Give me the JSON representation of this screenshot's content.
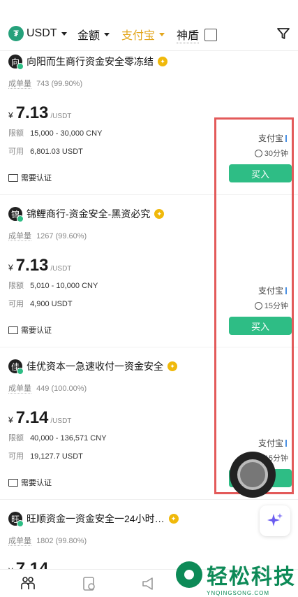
{
  "filters": {
    "coin": "USDT",
    "amount": "金额",
    "payment": "支付宝",
    "shield": "神盾"
  },
  "listings": [
    {
      "avatar": "向",
      "name": "向阳而生商行资金安全零冻结",
      "stats_label": "成单量",
      "stats_value": "743 (99.90%)",
      "currency": "¥",
      "price": "7.13",
      "unit": "/USDT",
      "limit_label": "限额",
      "limit": "15,000 - 30,000 CNY",
      "available_label": "可用",
      "available": "6,801.03 USDT",
      "verify": "需要认证",
      "payment": "支付宝",
      "time": "30分钟",
      "buy": "买入"
    },
    {
      "avatar": "锦",
      "name": "锦鲤商行-资金安全-黑资必究",
      "stats_label": "成单量",
      "stats_value": "1267 (99.60%)",
      "currency": "¥",
      "price": "7.13",
      "unit": "/USDT",
      "limit_label": "限额",
      "limit": "5,010 - 10,000 CNY",
      "available_label": "可用",
      "available": "4,900 USDT",
      "verify": "需要认证",
      "payment": "支付宝",
      "time": "15分钟",
      "buy": "买入"
    },
    {
      "avatar": "佳",
      "name": "佳优资本一急速收付一资金安全",
      "stats_label": "成单量",
      "stats_value": "449 (100.00%)",
      "currency": "¥",
      "price": "7.14",
      "unit": "/USDT",
      "limit_label": "限额",
      "limit": "40,000 - 136,571 CNY",
      "available_label": "可用",
      "available": "19,127.7 USDT",
      "verify": "需要认证",
      "payment": "支付宝",
      "time": "15分钟",
      "buy": "买入"
    },
    {
      "avatar": "旺",
      "name": "旺顺资金一资金安全一24小时…",
      "stats_label": "成单量",
      "stats_value": "1802 (99.80%)",
      "currency": "¥",
      "price": "7.14"
    }
  ],
  "watermark": {
    "text": "轻松科技",
    "sub": "YNQINGSONG.COM"
  },
  "colors": {
    "buy_green": "#2ebd85",
    "payment_gold": "#e2a51b",
    "highlight_red": "#e35a5a"
  }
}
